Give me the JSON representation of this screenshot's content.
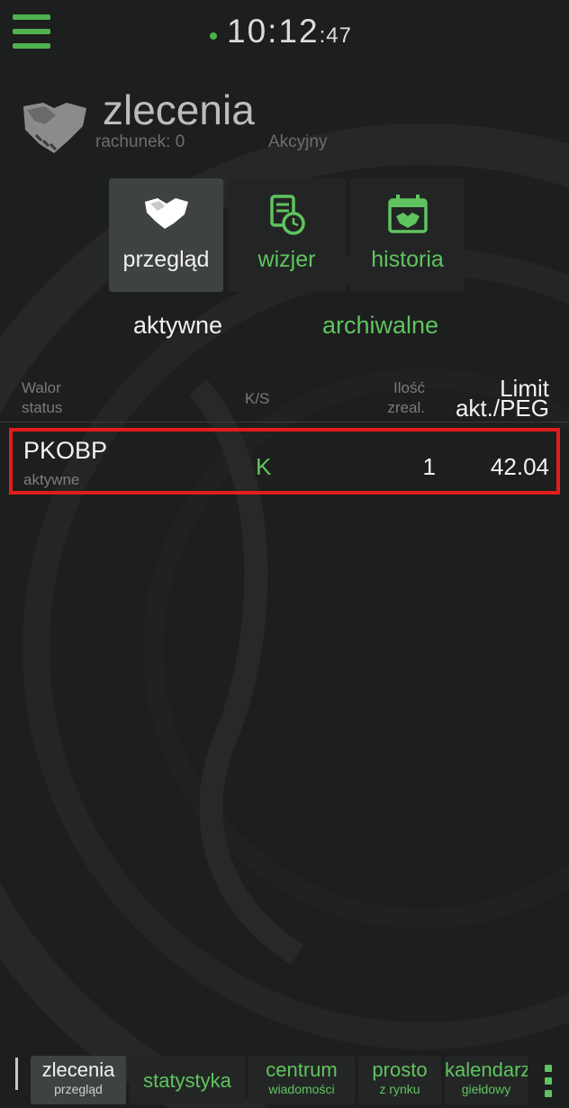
{
  "clock": {
    "hm": "10:12",
    "sec": ":47"
  },
  "header": {
    "title": "zlecenia",
    "account": "rachunek: 0",
    "account_type": "Akcyjny"
  },
  "tiles": [
    {
      "label": "przegląd",
      "icon": "handshake-icon"
    },
    {
      "label": "wizjer",
      "icon": "document-clock-icon"
    },
    {
      "label": "historia",
      "icon": "calendar-icon"
    }
  ],
  "subtabs": {
    "active": "aktywne",
    "archived": "archiwalne"
  },
  "table": {
    "headers": {
      "walor": "Walor",
      "status": "status",
      "ks": "K/S",
      "ilosc": "Ilość",
      "zreal": "zreal.",
      "limit": "Limit",
      "akt": "akt./PEG"
    },
    "rows": [
      {
        "walor": "PKOBP",
        "status": "aktywne",
        "ks": "K",
        "qty": "1",
        "limit": "42.04"
      }
    ]
  },
  "bottom_nav": [
    {
      "main": "zlecenia",
      "sub": "przegląd"
    },
    {
      "main": "statystyka",
      "sub": ""
    },
    {
      "main": "centrum",
      "sub": "wiadomości"
    },
    {
      "main": "prosto",
      "sub": "z rynku"
    },
    {
      "main": "kalendarz",
      "sub": "giełdowy"
    }
  ],
  "colors": {
    "accent": "#5fc45f",
    "highlight": "#e21d1d",
    "background": "#1d1e1e"
  }
}
